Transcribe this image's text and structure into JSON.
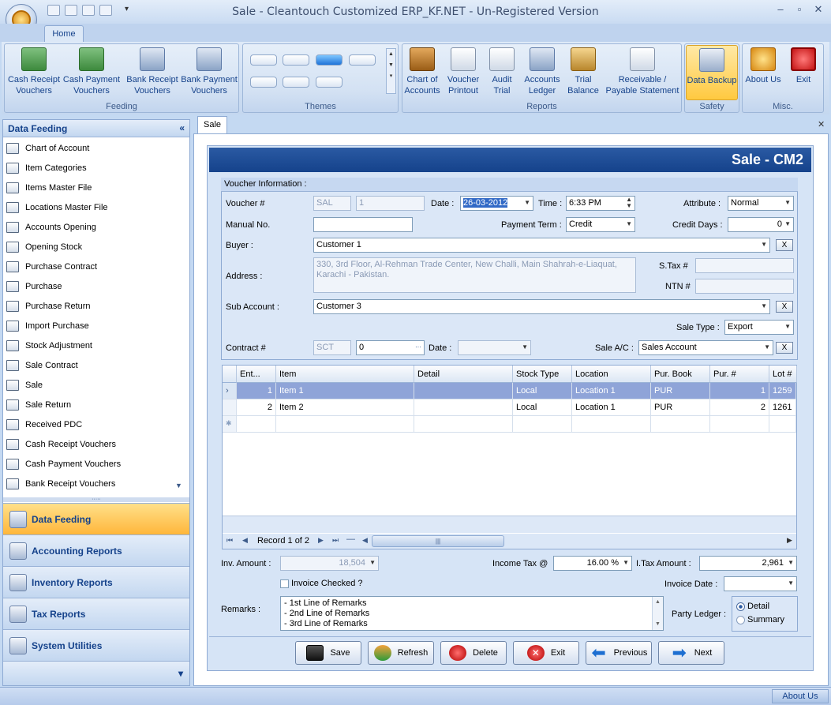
{
  "window": {
    "title": "Sale - Cleantouch Customized ERP_KF.NET - Un-Registered Version"
  },
  "ribbon": {
    "tab": "Home",
    "groups": {
      "feeding": "Feeding",
      "themes": "Themes",
      "reports": "Reports",
      "safety": "Safety",
      "misc": "Misc."
    },
    "buttons": {
      "cash_receipt": "Cash Receipt Vouchers",
      "cash_payment": "Cash Payment Vouchers",
      "bank_receipt": "Bank Receipt Vouchers",
      "bank_payment": "Bank Payment Vouchers",
      "chart_of_accounts": "Chart of Accounts",
      "voucher_printout": "Voucher Printout",
      "audit_trial": "Audit Trial",
      "accounts_ledger": "Accounts Ledger",
      "trial_balance": "Trial Balance",
      "receivable_payable": "Receivable / Payable Statement",
      "data_backup": "Data Backup",
      "about_us": "About Us",
      "exit": "Exit"
    }
  },
  "sidebar": {
    "header": "Data Feeding",
    "items": [
      "Chart of Account",
      "Item Categories",
      "Items Master File",
      "Locations Master File",
      "Accounts Opening",
      "Opening Stock",
      "Purchase Contract",
      "Purchase",
      "Purchase Return",
      "Import Purchase",
      "Stock Adjustment",
      "Sale Contract",
      "Sale",
      "Sale Return",
      "Received PDC",
      "Cash Receipt Vouchers",
      "Cash Payment Vouchers",
      "Bank Receipt Vouchers"
    ],
    "nav": [
      "Data Feeding",
      "Accounting Reports",
      "Inventory Reports",
      "Tax Reports",
      "System Utilities"
    ]
  },
  "doc_tab": "Sale",
  "form": {
    "title": "Sale - CM2",
    "section": "Voucher Information :",
    "labels": {
      "voucher": "Voucher #",
      "date": "Date :",
      "time": "Time :",
      "attribute": "Attribute :",
      "manual": "Manual No.",
      "payment_term": "Payment Term :",
      "credit_days": "Credit Days :",
      "buyer": "Buyer :",
      "address": "Address :",
      "stax": "S.Tax #",
      "ntn": "NTN #",
      "sub_account": "Sub Account :",
      "sale_type": "Sale Type :",
      "contract": "Contract #",
      "contract_date": "Date :",
      "sale_ac": "Sale A/C :",
      "inv_amount": "Inv. Amount :",
      "income_tax": "Income Tax @",
      "itax_amount": "I.Tax Amount :",
      "invoice_checked": "Invoice Checked ?",
      "invoice_date": "Invoice Date :",
      "remarks": "Remarks :",
      "party_ledger": "Party Ledger :"
    },
    "values": {
      "voucher_prefix": "SAL",
      "voucher_no": "1",
      "date": "26-03-2012",
      "time": "6:33 PM",
      "attribute": "Normal",
      "manual": "",
      "payment_term": "Credit",
      "credit_days": "0",
      "buyer": "Customer 1",
      "address": "330, 3rd Floor, Al-Rehman Trade Center, New Challi, Main Shahrah-e-Liaquat, Karachi - Pakistan.",
      "sub_account": "Customer 3",
      "sale_type": "Export",
      "contract_prefix": "SCT",
      "contract_no": "0",
      "sale_ac": "Sales Account",
      "inv_amount": "18,504",
      "income_tax": "16.00 %",
      "itax_amount": "2,961",
      "remarks": [
        "- 1st Line of Remarks",
        "- 2nd Line of Remarks",
        "- 3rd Line of Remarks"
      ],
      "ledger_detail": "Detail",
      "ledger_summary": "Summary",
      "x": "X"
    }
  },
  "grid": {
    "columns": [
      "Ent...",
      "Item",
      "Detail",
      "Stock Type",
      "Location",
      "Pur. Book",
      "Pur. #",
      "Lot #"
    ],
    "rows": [
      [
        "1",
        "Item 1",
        "",
        "Local",
        "Location 1",
        "PUR",
        "1",
        "1259"
      ],
      [
        "2",
        "Item 2",
        "",
        "Local",
        "Location 1",
        "PUR",
        "2",
        "1261"
      ]
    ],
    "record": "Record 1 of 2"
  },
  "buttons": {
    "save": "Save",
    "refresh": "Refresh",
    "delete": "Delete",
    "exit": "Exit",
    "previous": "Previous",
    "next": "Next"
  },
  "status": {
    "about": "About Us"
  }
}
